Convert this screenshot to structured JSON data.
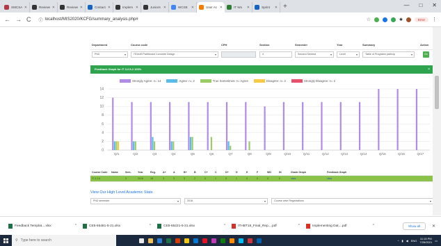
{
  "browser": {
    "tabs": [
      {
        "label": "SMCSA",
        "color": "#b23a48"
      },
      {
        "label": "Reviews",
        "color": "#333"
      },
      {
        "label": "Reviews",
        "color": "#333"
      },
      {
        "label": "Contact",
        "color": "#1565c0"
      },
      {
        "label": "Implem",
        "color": "#333"
      },
      {
        "label": "Juniors",
        "color": "#333"
      },
      {
        "label": "WCSE",
        "color": "#4285f4"
      },
      {
        "label": "User Ac",
        "color": "#f57c00",
        "active": true
      },
      {
        "label": "IT Wo",
        "color": "#2e7d32"
      },
      {
        "label": "Sprint",
        "color": "#1565c0"
      }
    ],
    "new_tab": "+",
    "url": "localhost/MIS2020/KCFG/summary_analysis.php#",
    "profile_error": "Error",
    "window_controls": [
      "—",
      "□",
      "✕"
    ]
  },
  "filters": {
    "headers": [
      "Department",
      "Course code",
      "CPH",
      "Section",
      "Semester",
      "Year",
      "Summary",
      "Action"
    ],
    "values": [
      "PhD",
      "ITDevE:Partitioned Concrete Design",
      "",
      "4",
      "Second Semest",
      "Level",
      "Table of Programs particip",
      "Go"
    ]
  },
  "panel_title": "Feedback Graph for IT 3.2.5-2 100%",
  "panel_close": "×",
  "chart_data": {
    "type": "bar",
    "categories": [
      "Q/1",
      "Q/2",
      "Q3",
      "Q4",
      "Q5",
      "Q6",
      "Q7",
      "Q8",
      "Q/9",
      "Q/10",
      "Q/11",
      "Q/12",
      "Q/13",
      "Q/14",
      "Q/15",
      "Q/16",
      "Q/17"
    ],
    "ylim": [
      0,
      14
    ],
    "yticks": [
      0,
      2,
      4,
      6,
      8,
      10,
      12,
      14
    ],
    "legend_texts": [
      "Strongly Agree: n= 14",
      "Agree: n= 2",
      "True Sometimes: n= Agree",
      "Disagree: n= 2",
      "Strongly Disagree: n= 2"
    ],
    "series": [
      {
        "name": "Strongly Agree",
        "color": "#b08be8",
        "values": [
          12,
          11,
          11,
          11,
          11,
          11,
          11,
          11,
          10,
          11,
          11,
          11,
          11,
          11,
          14,
          14,
          14
        ]
      },
      {
        "name": "Agree",
        "color": "#5bbbe8",
        "values": [
          2,
          2,
          3,
          2,
          3,
          0,
          2,
          0,
          0,
          0,
          0,
          0,
          0,
          0,
          0,
          0,
          0
        ]
      },
      {
        "name": "True Sometimes",
        "color": "#9ccc65",
        "values": [
          2,
          2,
          2,
          2,
          3,
          3,
          1,
          2,
          0,
          0,
          0,
          0,
          0,
          0,
          0,
          0,
          0
        ]
      },
      {
        "name": "Disagree",
        "color": "#f5cb45",
        "values": [
          2,
          0,
          0,
          0,
          0,
          0,
          0,
          0,
          0,
          0,
          0,
          0,
          0,
          0,
          0,
          0,
          0
        ]
      },
      {
        "name": "Strongly Disagree",
        "color": "#e8506a",
        "values": [
          0,
          0,
          0,
          0,
          0,
          0,
          0,
          0,
          0,
          0,
          0,
          0,
          0,
          0,
          0,
          0,
          0
        ]
      }
    ]
  },
  "table": {
    "headers": [
      "Course Code",
      "Name",
      "Sem.",
      "Year",
      "Reg.",
      "A+",
      "A",
      "B+",
      "B",
      "C+",
      "C",
      "D+",
      "D",
      "E",
      "F",
      "WD",
      "IN",
      "Grade Graph",
      "Feedback Graph"
    ],
    "row": [
      "IT-3.2.6",
      "",
      "3",
      "2016",
      "18",
      "3",
      "3",
      "3",
      "2",
      "0",
      "1",
      "0",
      "1",
      "0",
      "0",
      "0",
      "0",
      "view",
      "view"
    ]
  },
  "academic_link": "View Our High Level Academic Stats",
  "level_filters": [
    "PhD semester",
    "2016",
    "Course wise Registrations"
  ],
  "downloads": [
    {
      "name": "Feedback Templat....xlsx",
      "icon": "#1e7145"
    },
    {
      "name": "CE5-65481-5-21.xlsx",
      "icon": "#1e7145"
    },
    {
      "name": "CE5-65221-5-21.xlsx",
      "icon": "#1e7145"
    },
    {
      "name": "ITHBT18_Final_Rep....pdf",
      "icon": "#d93025"
    },
    {
      "name": "Implementing Dat....pdf",
      "icon": "#d93025"
    }
  ],
  "show_all": "Show all",
  "taskbar": {
    "search_placeholder": "Type here to search",
    "apps": [
      "#e8e8e8",
      "#f0c05a",
      "#2b7cd3",
      "#1e7145",
      "#d83b01",
      "#f2c811",
      "#0078d4",
      "#e81123",
      "#c239b3",
      "#107c10",
      "#ff8c00",
      "#00bcf2",
      "#d13438",
      "#0063b1"
    ],
    "time": "11:15 PM",
    "date": "7/26/2021",
    "lang": "ENG"
  }
}
